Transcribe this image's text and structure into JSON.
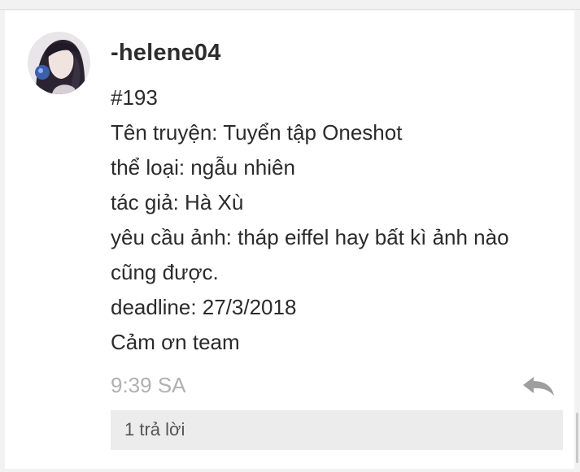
{
  "comment": {
    "username": "-helene04",
    "body_lines": [
      "#193",
      "Tên truyện: Tuyển tập Oneshot",
      "thể loại: ngẫu nhiên",
      "tác giả: Hà Xù",
      "yêu cầu ảnh: tháp eiffel hay bất kì ảnh nào",
      "cũng được.",
      "deadline: 27/3/2018",
      "Cảm ơn team"
    ],
    "timestamp": "9:39 SA",
    "reply_icon": "reply-arrow-icon",
    "replies_label": "1 trả lời"
  },
  "colors": {
    "background": "#f2f2f2",
    "card": "#ffffff",
    "text": "#2b2b2b",
    "muted": "#b0b0b0",
    "replies_bar": "#ececec"
  }
}
